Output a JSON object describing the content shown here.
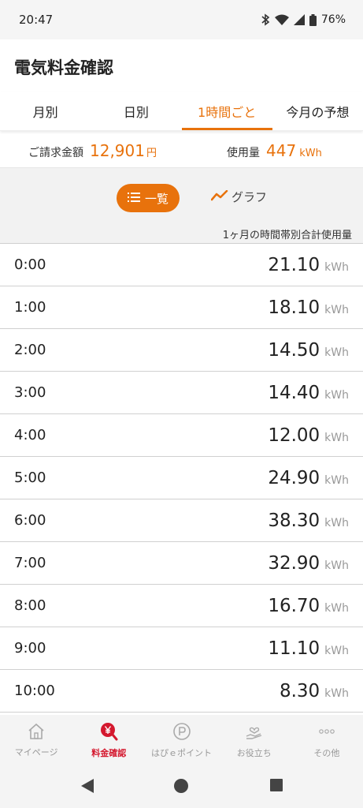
{
  "status_bar": {
    "time": "20:47",
    "battery": "76%"
  },
  "app": {
    "title": "電気料金確認"
  },
  "tabs": [
    {
      "label": "月別",
      "active": false
    },
    {
      "label": "日別",
      "active": false
    },
    {
      "label": "1時間ごと",
      "active": true
    },
    {
      "label": "今月の予想",
      "active": false
    }
  ],
  "summary": {
    "billing_label": "ご請求金額",
    "billing_value": "12,901",
    "billing_unit": "円",
    "usage_label": "使用量",
    "usage_value": "447",
    "usage_unit": "kWh"
  },
  "view_toggle": {
    "list_label": "一覧",
    "graph_label": "グラフ",
    "selected": "list"
  },
  "caption": "1ヶ月の時間帯別合計使用量",
  "hourly": [
    {
      "time": "0:00",
      "value": "21.10",
      "unit": "kWh"
    },
    {
      "time": "1:00",
      "value": "18.10",
      "unit": "kWh"
    },
    {
      "time": "2:00",
      "value": "14.50",
      "unit": "kWh"
    },
    {
      "time": "3:00",
      "value": "14.40",
      "unit": "kWh"
    },
    {
      "time": "4:00",
      "value": "12.00",
      "unit": "kWh"
    },
    {
      "time": "5:00",
      "value": "24.90",
      "unit": "kWh"
    },
    {
      "time": "6:00",
      "value": "38.30",
      "unit": "kWh"
    },
    {
      "time": "7:00",
      "value": "32.90",
      "unit": "kWh"
    },
    {
      "time": "8:00",
      "value": "16.70",
      "unit": "kWh"
    },
    {
      "time": "9:00",
      "value": "11.10",
      "unit": "kWh"
    },
    {
      "time": "10:00",
      "value": "8.30",
      "unit": "kWh"
    }
  ],
  "bottom_nav": [
    {
      "label": "マイページ",
      "icon": "home-icon",
      "active": false
    },
    {
      "label": "料金確認",
      "icon": "yen-search-icon",
      "active": true
    },
    {
      "label": "はぴｅポイント",
      "icon": "point-icon",
      "active": false
    },
    {
      "label": "お役立ち",
      "icon": "heart-hand-icon",
      "active": false
    },
    {
      "label": "その他",
      "icon": "more-icon",
      "active": false
    }
  ],
  "colors": {
    "accent": "#e8720c",
    "nav_active": "#d4182e"
  }
}
